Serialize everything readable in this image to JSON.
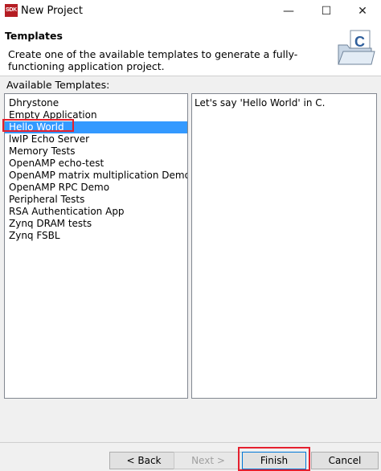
{
  "window": {
    "icon_text": "SDK",
    "title": "New Project",
    "minimize_glyph": "—",
    "maximize_glyph": "☐",
    "close_glyph": "✕"
  },
  "header": {
    "title": "Templates",
    "description": "Create one of the available templates to generate a fully-functioning application project.",
    "graphic_letter": "C",
    "graphic_icon": "new-c-project-folder-icon"
  },
  "templates": {
    "label": "Available Templates:",
    "items": [
      "Dhrystone",
      "Empty Application",
      "Hello World",
      "lwIP Echo Server",
      "Memory Tests",
      "OpenAMP echo-test",
      "OpenAMP matrix multiplication Demo",
      "OpenAMP RPC Demo",
      "Peripheral Tests",
      "RSA Authentication App",
      "Zynq DRAM tests",
      "Zynq FSBL"
    ],
    "selected_index": 2,
    "description": "Let's say 'Hello World' in C."
  },
  "buttons": {
    "back": "< Back",
    "next": "Next >",
    "finish": "Finish",
    "cancel": "Cancel"
  },
  "colors": {
    "selection": "#3399ff",
    "highlight_box": "#e5202e",
    "app_icon": "#b51d23"
  }
}
